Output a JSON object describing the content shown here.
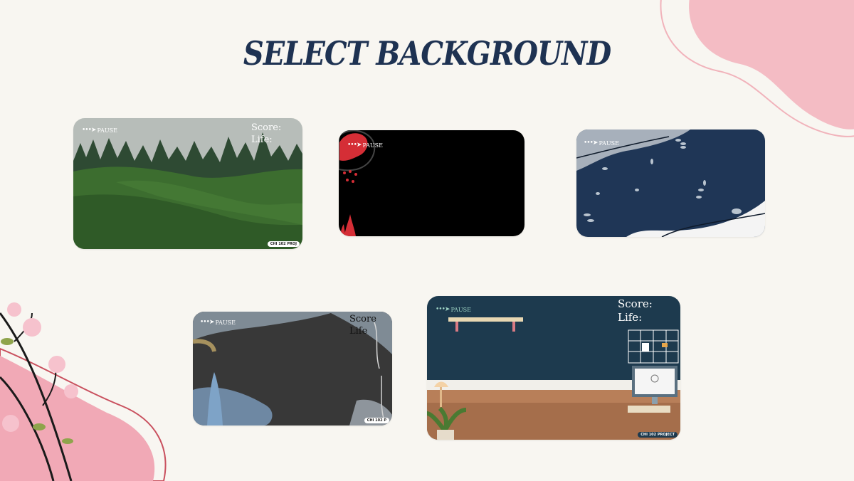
{
  "screen": {
    "title": "SELECT BACKGROUND"
  },
  "cards": [
    {
      "name": "forest",
      "pause": "PAUSE",
      "score": "Score:",
      "life": "Life:",
      "badge": "CHI 102 PROJ"
    },
    {
      "name": "black-red",
      "pause": "PAUSE"
    },
    {
      "name": "navy-leaves",
      "pause": "PAUSE"
    },
    {
      "name": "dark-gray",
      "pause": "PAUSE",
      "score": "Score",
      "life": "Life",
      "badge": "CHI 102 P"
    },
    {
      "name": "desk-room",
      "pause": "PAUSE",
      "score": "Score:",
      "life": "Life:",
      "badge": "CHI 102 PROJECT"
    }
  ],
  "colors": {
    "title": "#1e3252",
    "page": "#f8f6f1",
    "pink": "#f3bcc3",
    "navy": "#1f3656",
    "desk_wall": "#1d3a4e",
    "forest": "#2f5a27"
  }
}
